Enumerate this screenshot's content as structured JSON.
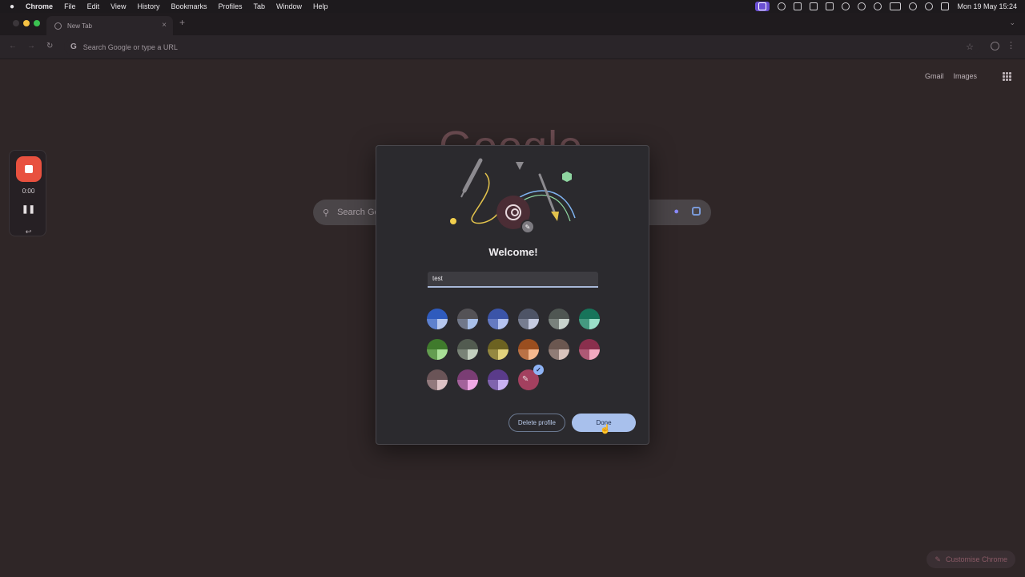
{
  "menubar": {
    "apple": "",
    "app_name": "Chrome",
    "items": [
      "File",
      "Edit",
      "View",
      "History",
      "Bookmarks",
      "Profiles",
      "Tab",
      "Window",
      "Help"
    ],
    "clock": "Mon 19 May  15:24"
  },
  "tab": {
    "title": "New Tab",
    "close": "×",
    "new": "+"
  },
  "toolbar": {
    "omnibox_placeholder": "Search Google or type a URL",
    "g_letter": "G"
  },
  "ntp": {
    "logo": "Google",
    "links": [
      "Gmail",
      "Images"
    ],
    "search_placeholder": "Search Google or type a URL",
    "customise": "Customise Chrome"
  },
  "recorder": {
    "time": "0:00",
    "pause": "❚❚",
    "undo": "↩"
  },
  "dialog": {
    "title": "Welcome!",
    "name_value": "test",
    "delete_label": "Delete profile",
    "done_label": "Done",
    "colors": [
      {
        "a": "#2f5bbd",
        "b": "#b7c8ef"
      },
      {
        "a": "#545256",
        "b": "#a9c0ea"
      },
      {
        "a": "#3b54a8",
        "b": "#b5c3f1"
      },
      {
        "a": "#4e5466",
        "b": "#c5cbe0"
      },
      {
        "a": "#4f5652",
        "b": "#c8d2cc"
      },
      {
        "a": "#17745a",
        "b": "#9be0c9"
      },
      {
        "a": "#3f7a2c",
        "b": "#a9df97"
      },
      {
        "a": "#525b50",
        "b": "#c3cfbf"
      },
      {
        "a": "#6c6221",
        "b": "#e2d27d"
      },
      {
        "a": "#9a4e1f",
        "b": "#f4b88e"
      },
      {
        "a": "#6b5750",
        "b": "#d8c3bc"
      },
      {
        "a": "#8a2f4d",
        "b": "#f2a9c0"
      },
      {
        "a": "#6a5457",
        "b": "#dcc2c5"
      },
      {
        "a": "#7a3d74",
        "b": "#f0a8e5"
      },
      {
        "a": "#5a3b8a",
        "b": "#c9b1f2"
      }
    ],
    "custom_color": "#a3405f"
  }
}
